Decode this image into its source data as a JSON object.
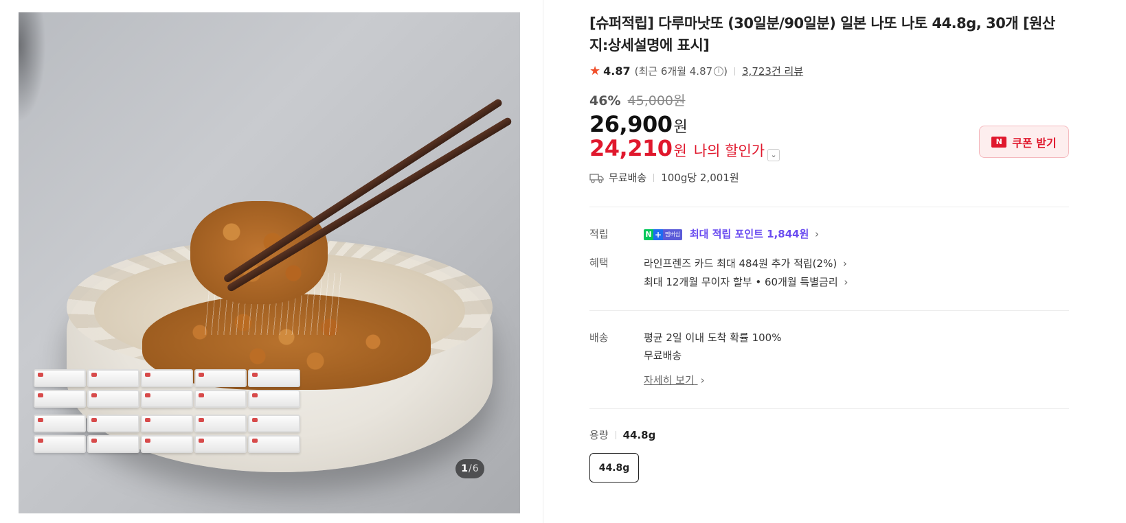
{
  "gallery": {
    "current": "1",
    "separator": "/",
    "total": "6"
  },
  "product": {
    "title": "[슈퍼적립] 다루마낫또 (30일분/90일분) 일본 나또 나토 44.8g, 30개 [원산지:상세설명에 표시]",
    "rating": "4.87",
    "recent_rating": "(최근 6개월 4.87",
    "recent_rating_close": ")",
    "review_count": "3,723건 리뷰",
    "discount_rate": "46%",
    "original_price": "45,000원",
    "price": "26,900",
    "price_unit": "원",
    "my_price": "24,210",
    "my_price_unit": "원",
    "my_price_label": "나의 할인가",
    "shipping": "무료배송",
    "unit_price": "100g당 2,001원"
  },
  "coupon": {
    "icon_text": "N",
    "label": "쿠폰 받기"
  },
  "benefits": {
    "point_label": "적립",
    "badge_n": "N",
    "badge_plus": "+",
    "badge_membership": "멤버십",
    "point_text": "최대 적립 포인트 1,844원",
    "benefit_label": "혜택",
    "benefit_line1": "라인프렌즈 카드 최대 484원 추가 적립(2%)",
    "benefit_line2": "최대 12개월 무이자 할부 • 60개월 특별금리"
  },
  "delivery": {
    "label": "배송",
    "line1": "평균 2일 이내 도착 확률 100%",
    "line2": "무료배송",
    "detail_link": "자세히 보기"
  },
  "option": {
    "label": "용량",
    "selected": "44.8g",
    "choice": "44.8g"
  },
  "colors": {
    "sale_red": "#e0182d",
    "point_purple": "#6a4cf0",
    "naver_green": "#03c75a"
  }
}
